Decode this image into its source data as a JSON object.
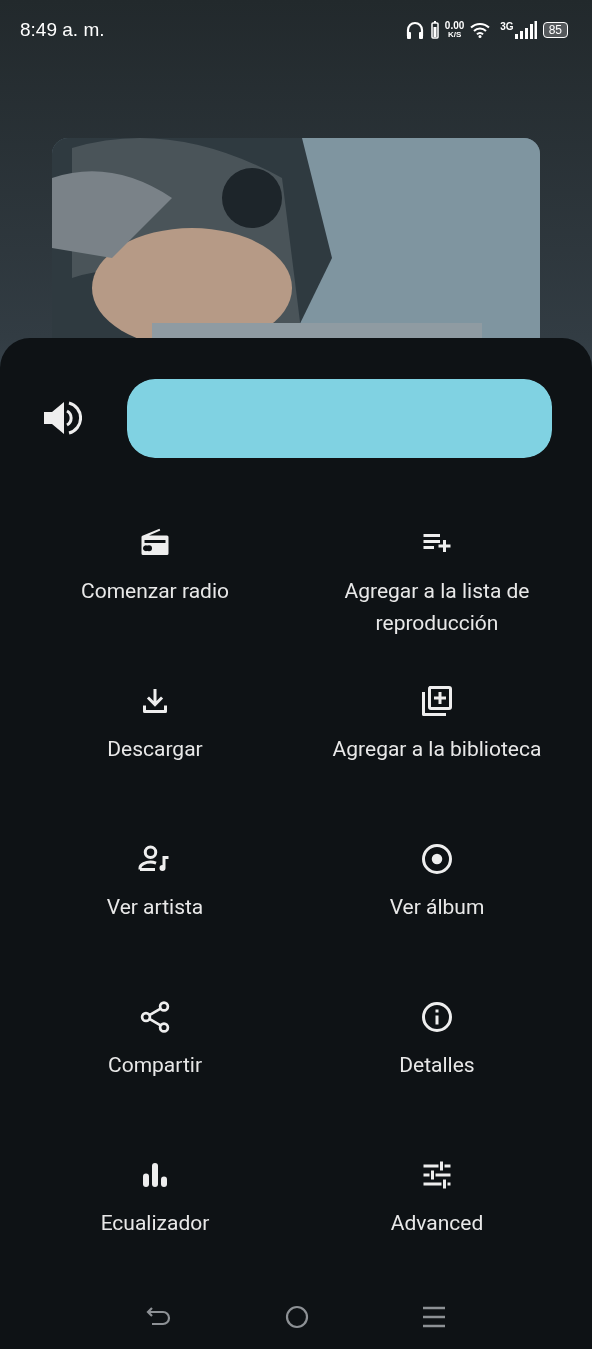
{
  "status_bar": {
    "time": "8:49 a. m.",
    "net_speed": "0.00",
    "net_unit": "K/S",
    "network": "3G",
    "battery": "85"
  },
  "volume": {
    "level": 1
  },
  "actions": [
    {
      "kind": "radio",
      "label": "Comenzar radio"
    },
    {
      "kind": "playlist_add",
      "label": "Agregar a la lista de reproducción"
    },
    {
      "kind": "download",
      "label": "Descargar"
    },
    {
      "kind": "library_add",
      "label": "Agregar a la biblioteca"
    },
    {
      "kind": "artist",
      "label": "Ver artista"
    },
    {
      "kind": "album",
      "label": "Ver álbum"
    },
    {
      "kind": "share",
      "label": "Compartir"
    },
    {
      "kind": "info",
      "label": "Detalles"
    },
    {
      "kind": "equalizer",
      "label": "Ecualizador"
    },
    {
      "kind": "advanced",
      "label": "Advanced"
    }
  ]
}
